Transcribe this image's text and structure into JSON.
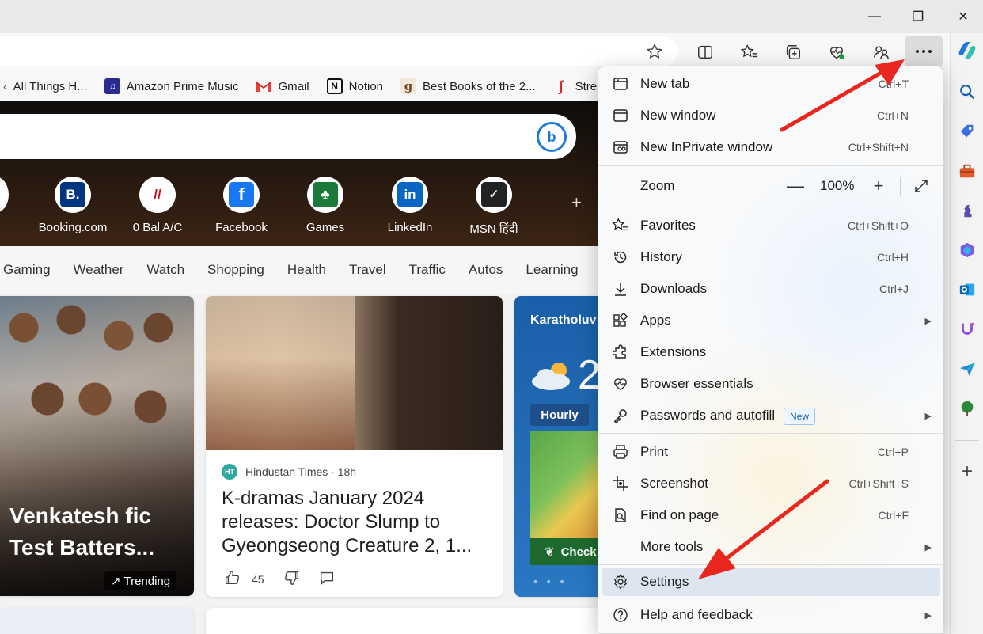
{
  "window": {
    "minimize": "—",
    "restore": "❐",
    "close": "✕"
  },
  "bookmarks": [
    {
      "label": "All Things H...",
      "icon": "chevron-icon"
    },
    {
      "label": "Amazon Prime Music",
      "icon": "amazon-music-icon"
    },
    {
      "label": "Gmail",
      "icon": "gmail-icon"
    },
    {
      "label": "Notion",
      "icon": "notion-icon"
    },
    {
      "label": "Best Books of the 2...",
      "icon": "goodreads-icon"
    },
    {
      "label": "Strear",
      "icon": "stream-icon"
    }
  ],
  "quick_links": [
    {
      "label": "Booking.com",
      "glyph": "B.",
      "color": "#003580"
    },
    {
      "label": "0 Bal A/C",
      "glyph": "//",
      "color": "#c0161d"
    },
    {
      "label": "Facebook",
      "glyph": "f",
      "color": "#1877f2"
    },
    {
      "label": "Games",
      "glyph": "♣",
      "color": "#1b7a3a"
    },
    {
      "label": "LinkedIn",
      "glyph": "in",
      "color": "#0a66c2"
    },
    {
      "label": "MSN हिंदी",
      "glyph": "✓",
      "color": "#222222"
    }
  ],
  "nav": [
    "Gaming",
    "Weather",
    "Watch",
    "Shopping",
    "Health",
    "Travel",
    "Traffic",
    "Autos",
    "Learning"
  ],
  "card1": {
    "headline": "Venkatesh fic Test Batters...",
    "badge": "Trending"
  },
  "card2": {
    "source": "Hindustan Times · 18h",
    "source_badge": "HT",
    "title": "K-dramas January 2024 releases: Doctor Slump to Gyeongseong Creature 2, 1...",
    "likes": "45"
  },
  "card3": {
    "location": "Karatholuv",
    "temp": "2",
    "hourly": "Hourly",
    "check": "Check",
    "dots": "• • •"
  },
  "menu": {
    "items": [
      {
        "label": "New tab",
        "shortcut": "Ctrl+T"
      },
      {
        "label": "New window",
        "shortcut": "Ctrl+N"
      },
      {
        "label": "New InPrivate window",
        "shortcut": "Ctrl+Shift+N"
      },
      {
        "label": "Favorites",
        "shortcut": "Ctrl+Shift+O"
      },
      {
        "label": "History",
        "shortcut": "Ctrl+H"
      },
      {
        "label": "Downloads",
        "shortcut": "Ctrl+J"
      },
      {
        "label": "Apps",
        "shortcut": ""
      },
      {
        "label": "Extensions",
        "shortcut": ""
      },
      {
        "label": "Browser essentials",
        "shortcut": ""
      },
      {
        "label": "Passwords and autofill",
        "shortcut": "",
        "badge": "New"
      },
      {
        "label": "Print",
        "shortcut": "Ctrl+P"
      },
      {
        "label": "Screenshot",
        "shortcut": "Ctrl+Shift+S"
      },
      {
        "label": "Find on page",
        "shortcut": "Ctrl+F"
      },
      {
        "label": "More tools",
        "shortcut": ""
      },
      {
        "label": "Settings",
        "shortcut": ""
      },
      {
        "label": "Help and feedback",
        "shortcut": ""
      }
    ],
    "zoom": {
      "label": "Zoom",
      "value": "100%",
      "minus": "—",
      "plus": "+"
    }
  },
  "colors": {
    "accent": "#1a63b8",
    "arrow": "#e8281f",
    "selected": "#dde6f0"
  }
}
